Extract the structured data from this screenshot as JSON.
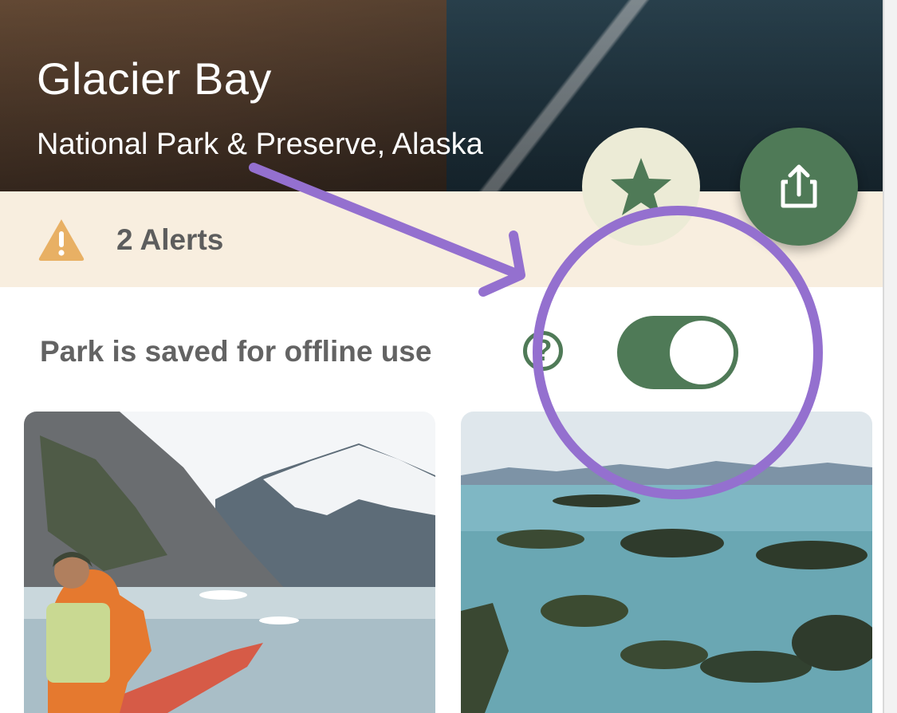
{
  "header": {
    "title": "Glacier Bay",
    "subtitle": "National Park & Preserve, Alaska"
  },
  "actions": {
    "favorite_icon": "star-icon",
    "share_icon": "share-icon"
  },
  "alerts": {
    "label": "2 Alerts",
    "icon": "warning-icon"
  },
  "offline": {
    "label": "Park is saved for offline use",
    "help": "?",
    "enabled": true
  },
  "colors": {
    "accent": "#4f7a57",
    "alert_background": "#f8eedf",
    "warning": "#e8b064",
    "annotation": "#9470cf"
  }
}
